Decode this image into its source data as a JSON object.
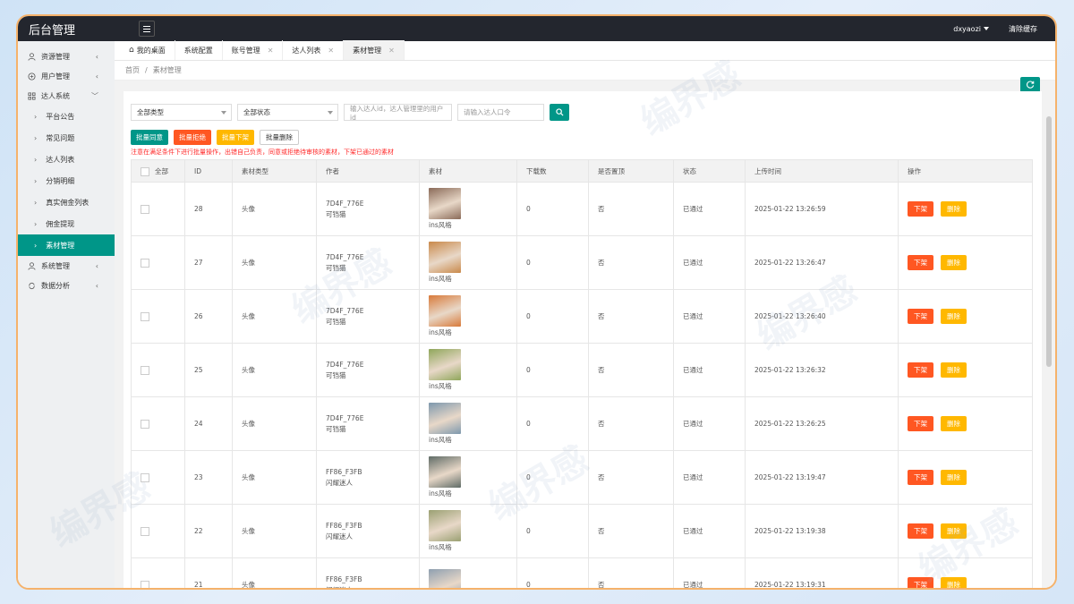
{
  "app": {
    "title": "后台管理"
  },
  "header": {
    "user": "dxyaozi",
    "clear_cache": "清除缓存"
  },
  "sidebar": {
    "items": [
      {
        "label": "资源管理",
        "icon": "user-icon",
        "expanded": false
      },
      {
        "label": "用户管理",
        "icon": "globe-icon",
        "expanded": false
      },
      {
        "label": "达人系统",
        "icon": "grid-icon",
        "expanded": true
      },
      {
        "label": "系统管理",
        "icon": "user-icon",
        "expanded": false
      },
      {
        "label": "数据分析",
        "icon": "sync-icon",
        "expanded": false
      }
    ],
    "sub_items": [
      {
        "label": "平台公告"
      },
      {
        "label": "常见问题"
      },
      {
        "label": "达人列表"
      },
      {
        "label": "分销明细"
      },
      {
        "label": "真实佣金列表"
      },
      {
        "label": "佣金提现"
      },
      {
        "label": "素材管理",
        "active": true
      }
    ]
  },
  "tabs": [
    {
      "label": "我的桌面",
      "closable": false
    },
    {
      "label": "系统配置",
      "closable": false
    },
    {
      "label": "账号管理",
      "closable": true
    },
    {
      "label": "达人列表",
      "closable": true
    },
    {
      "label": "素材管理",
      "closable": true,
      "active": true
    }
  ],
  "breadcrumb": {
    "home": "首页",
    "current": "素材管理"
  },
  "filters": {
    "type_select": "全部类型",
    "status_select": "全部状态",
    "search_id_placeholder": "输入达人id，达人管理里的用户id",
    "search_code_placeholder": "请输入达人口令"
  },
  "batch": {
    "approve": "批量同意",
    "reject": "批量拒绝",
    "offline": "批量下架",
    "delete": "批量删除",
    "warning": "注意在满足条件下进行批量操作，出错自己负责，同意或拒绝待审核的素材，下架已通过的素材"
  },
  "table": {
    "headers": [
      "全部",
      "ID",
      "素材类型",
      "作者",
      "素材",
      "下载数",
      "是否置顶",
      "状态",
      "上传时间",
      "操作"
    ],
    "action_offline": "下架",
    "action_delete": "删除",
    "rows": [
      {
        "id": "28",
        "type": "头像",
        "author_id": "7D4F_776E",
        "author_name": "可铛猫",
        "material": "ins风格",
        "downloads": "0",
        "pinned": "否",
        "status": "已通过",
        "time": "2025-01-22 13:26:59",
        "thumb_color": "#8a6a58"
      },
      {
        "id": "27",
        "type": "头像",
        "author_id": "7D4F_776E",
        "author_name": "可铛猫",
        "material": "ins风格",
        "downloads": "0",
        "pinned": "否",
        "status": "已通过",
        "time": "2025-01-22 13:26:47",
        "thumb_color": "#c9894a"
      },
      {
        "id": "26",
        "type": "头像",
        "author_id": "7D4F_776E",
        "author_name": "可铛猫",
        "material": "ins风格",
        "downloads": "0",
        "pinned": "否",
        "status": "已通过",
        "time": "2025-01-22 13:26:40",
        "thumb_color": "#d87a3a"
      },
      {
        "id": "25",
        "type": "头像",
        "author_id": "7D4F_776E",
        "author_name": "可铛猫",
        "material": "ins风格",
        "downloads": "0",
        "pinned": "否",
        "status": "已通过",
        "time": "2025-01-22 13:26:32",
        "thumb_color": "#8fa65a"
      },
      {
        "id": "24",
        "type": "头像",
        "author_id": "7D4F_776E",
        "author_name": "可铛猫",
        "material": "ins风格",
        "downloads": "0",
        "pinned": "否",
        "status": "已通过",
        "time": "2025-01-22 13:26:25",
        "thumb_color": "#7d98ad"
      },
      {
        "id": "23",
        "type": "头像",
        "author_id": "FF86_F3FB",
        "author_name": "闪耀迷人",
        "material": "ins风格",
        "downloads": "0",
        "pinned": "否",
        "status": "已通过",
        "time": "2025-01-22 13:19:47",
        "thumb_color": "#5f6b66"
      },
      {
        "id": "22",
        "type": "头像",
        "author_id": "FF86_F3FB",
        "author_name": "闪耀迷人",
        "material": "ins风格",
        "downloads": "0",
        "pinned": "否",
        "status": "已通过",
        "time": "2025-01-22 13:19:38",
        "thumb_color": "#9aa072"
      },
      {
        "id": "21",
        "type": "头像",
        "author_id": "FF86_F3FB",
        "author_name": "闪耀迷人",
        "material": "",
        "downloads": "0",
        "pinned": "否",
        "status": "已通过",
        "time": "2025-01-22 13:19:31",
        "thumb_color": "#8e9fb0"
      }
    ]
  },
  "watermark": "编界感",
  "colors": {
    "accent": "#009688",
    "danger": "#ff5722",
    "warning": "#ffb800",
    "topbar": "#23262e"
  }
}
